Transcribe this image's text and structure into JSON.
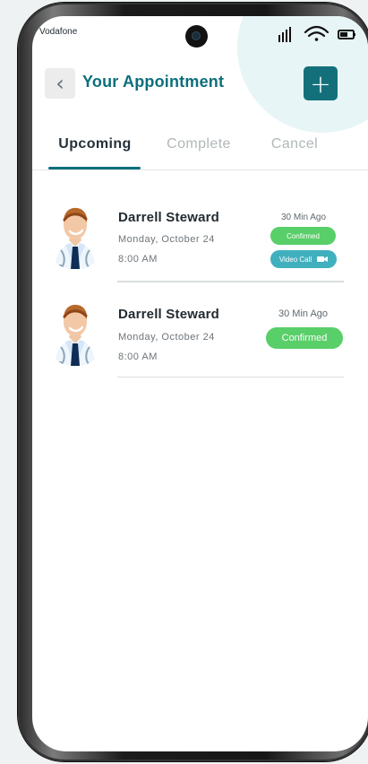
{
  "status_bar": {
    "carrier": "Vodafone",
    "icons": [
      "signal-icon",
      "wifi-icon",
      "battery-icon"
    ]
  },
  "header": {
    "title": "Your Appointment",
    "back_icon": "chevron-left-icon",
    "add_icon": "plus-icon"
  },
  "tabs": [
    {
      "label": "Upcoming",
      "active": true
    },
    {
      "label": "Complete",
      "active": false
    },
    {
      "label": "Cancel",
      "active": false
    }
  ],
  "appointments": [
    {
      "doctor_name": "Darrell Steward",
      "date": "Monday, October 24",
      "time": "8:00 AM",
      "time_ago": "30 Min Ago",
      "status": "Confirmed",
      "video_call": "Video Call",
      "video_icon": "video-camera-icon"
    },
    {
      "doctor_name": "Darrell Steward",
      "date": "Monday, October 24",
      "time": "8:00 AM",
      "time_ago": "30 Min Ago",
      "status": "Confirmed"
    }
  ],
  "colors": {
    "accent": "#13707b",
    "title": "#0b6f7b",
    "confirmed": "#58cf68",
    "video": "#40b0be",
    "background": "#ffffff"
  }
}
